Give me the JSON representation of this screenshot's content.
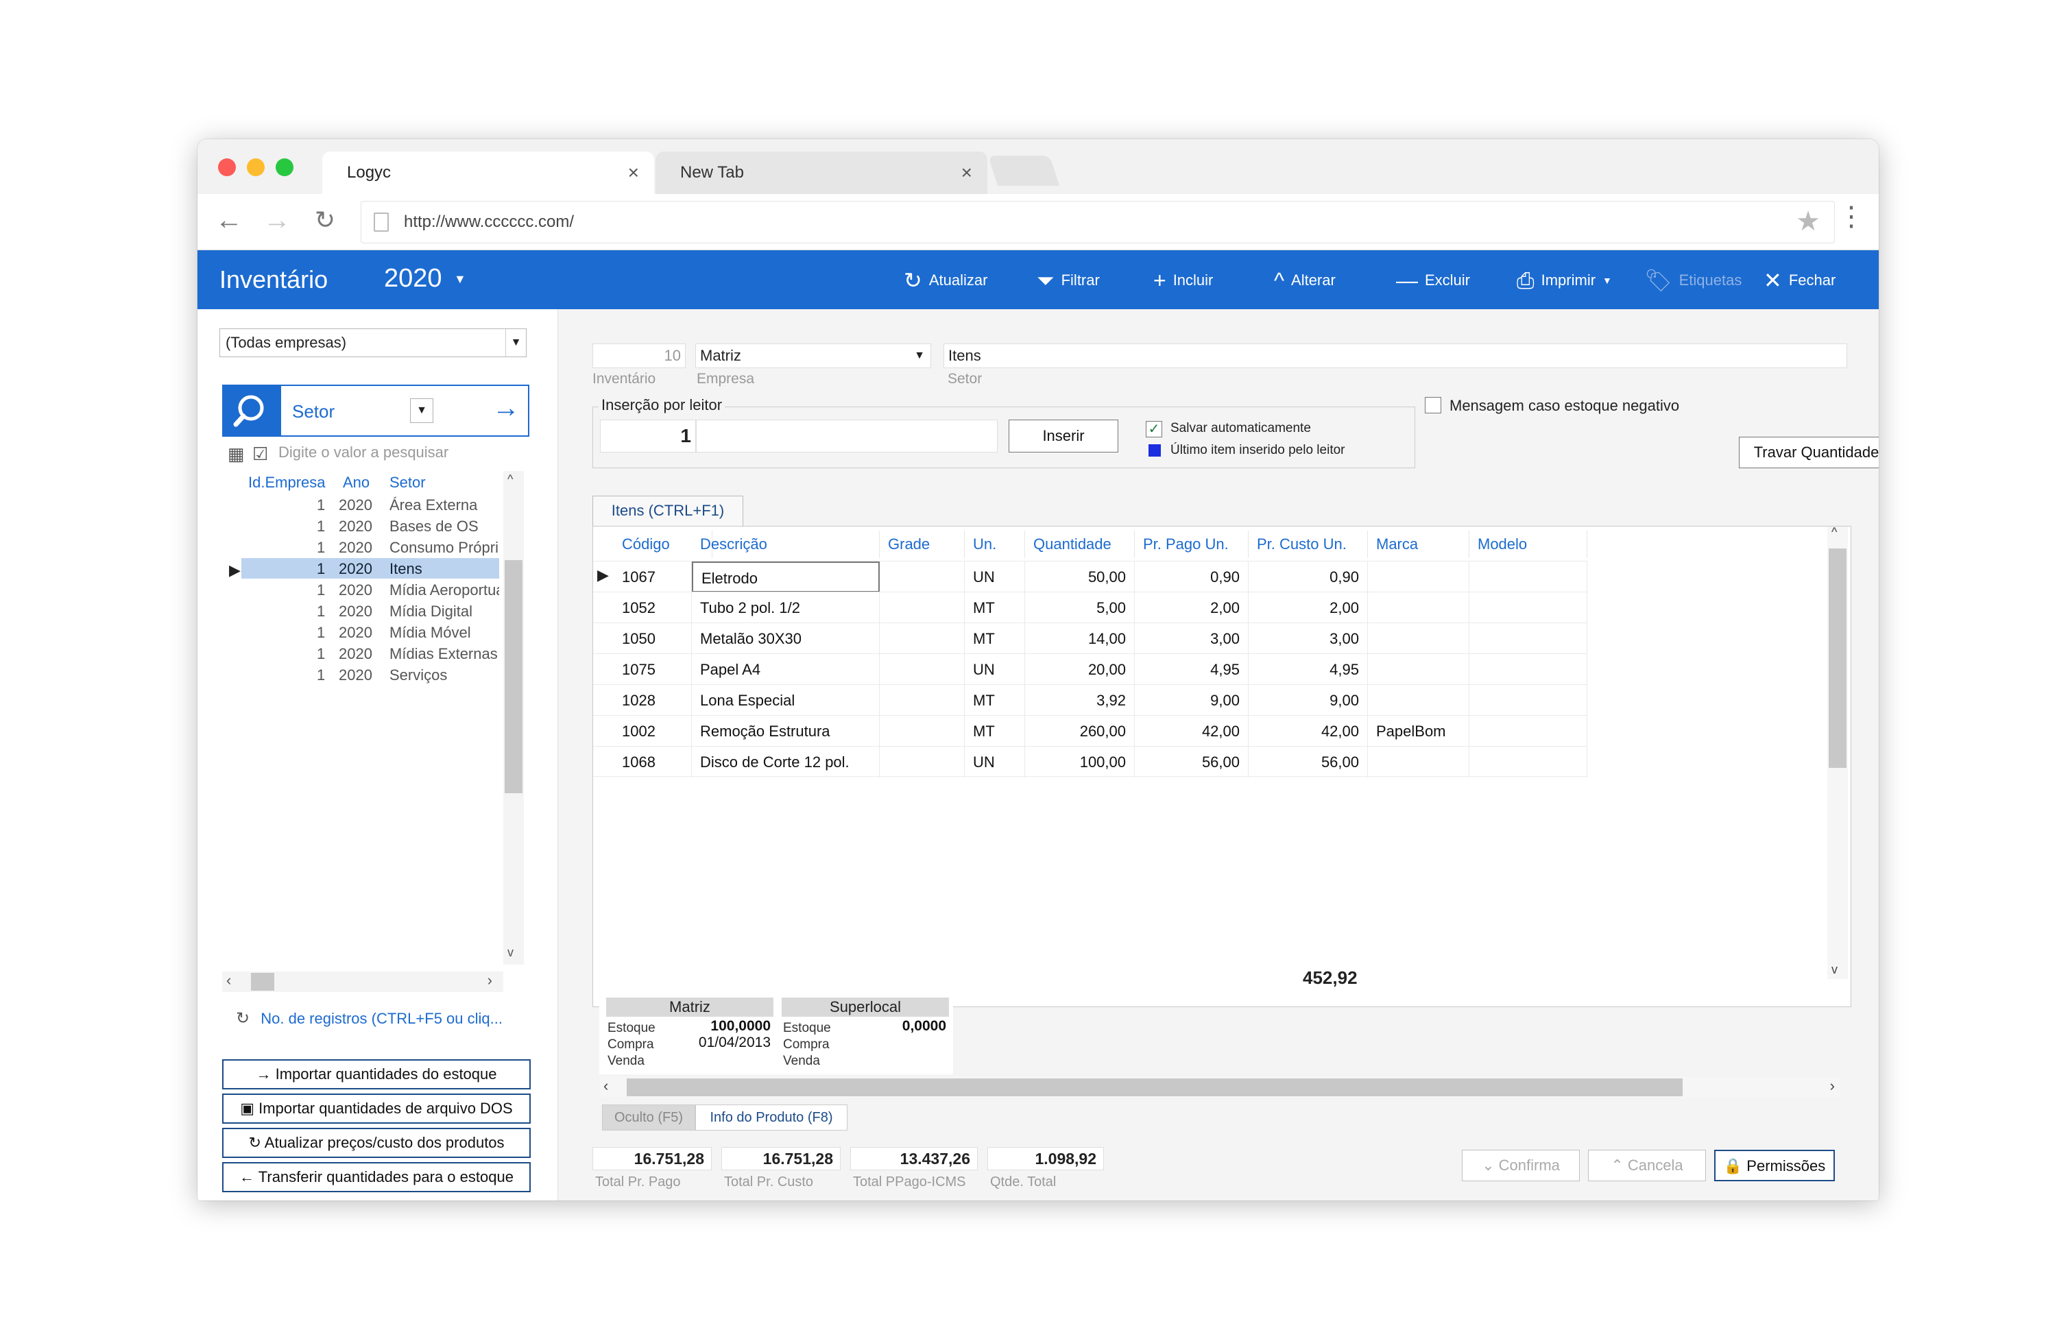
{
  "browser": {
    "tabs": [
      {
        "label": "Logyc"
      },
      {
        "label": "New Tab"
      }
    ],
    "url": "http://www.cccccc.com/"
  },
  "app": {
    "title": "Inventário",
    "year": "2020",
    "toolbar": {
      "atualizar": "Atualizar",
      "filtrar": "Filtrar",
      "incluir": "Incluir",
      "alterar": "Alterar",
      "excluir": "Excluir",
      "imprimir": "Imprimir",
      "etiquetas": "Etiquetas",
      "fechar": "Fechar"
    }
  },
  "left": {
    "company_combo": "(Todas empresas)",
    "search_label": "Setor",
    "search_hint": "Digite o valor a pesquisar",
    "tree_headers": {
      "empresa": "Id.Empresa",
      "ano": "Ano",
      "setor": "Setor"
    },
    "tree_rows": [
      {
        "id": "1",
        "ano": "2020",
        "setor": "Área Externa"
      },
      {
        "id": "1",
        "ano": "2020",
        "setor": "Bases de OS"
      },
      {
        "id": "1",
        "ano": "2020",
        "setor": "Consumo Próprio"
      },
      {
        "id": "1",
        "ano": "2020",
        "setor": "Itens"
      },
      {
        "id": "1",
        "ano": "2020",
        "setor": "Mídia Aeroportuária"
      },
      {
        "id": "1",
        "ano": "2020",
        "setor": "Mídia Digital"
      },
      {
        "id": "1",
        "ano": "2020",
        "setor": "Mídia Móvel"
      },
      {
        "id": "1",
        "ano": "2020",
        "setor": "Mídias Externas"
      },
      {
        "id": "1",
        "ano": "2020",
        "setor": "Serviços"
      }
    ],
    "records_link": "No. de registros (CTRL+F5 ou cliq...",
    "buttons": {
      "importar_estoque": "Importar quantidades do estoque",
      "importar_dos": "Importar quantidades de arquivo DOS",
      "atualizar_precos": "Atualizar preços/custo dos produtos",
      "transferir": "Transferir quantidades para o estoque"
    }
  },
  "form": {
    "inventario_value": "10",
    "inventario_label": "Inventário",
    "empresa_value": "Matriz",
    "empresa_label": "Empresa",
    "setor_value": "Itens",
    "setor_label": "Setor",
    "insercao_title": "Inserção por leitor",
    "insercao_qty": "1",
    "inserir_button": "Inserir",
    "salvar_auto": "Salvar automaticamente",
    "ultimo_item": "Último item inserido pelo leitor",
    "mensagem_estoque": "Mensagem caso estoque negativo",
    "travar_button": "Travar Quantidade",
    "items_tab": "Itens (CTRL+F1)"
  },
  "grid": {
    "headers": {
      "codigo": "Código",
      "descricao": "Descrição",
      "grade": "Grade",
      "un": "Un.",
      "quantidade": "Quantidade",
      "pr_pago": "Pr. Pago Un.",
      "pr_custo": "Pr. Custo Un.",
      "marca": "Marca",
      "modelo": "Modelo"
    },
    "rows": [
      {
        "codigo": "1067",
        "descricao": "Eletrodo",
        "grade": "",
        "un": "UN",
        "quantidade": "50,00",
        "pr_pago": "0,90",
        "pr_custo": "0,90",
        "marca": "",
        "modelo": ""
      },
      {
        "codigo": "1052",
        "descricao": "Tubo 2 pol. 1/2",
        "grade": "",
        "un": "MT",
        "quantidade": "5,00",
        "pr_pago": "2,00",
        "pr_custo": "2,00",
        "marca": "",
        "modelo": ""
      },
      {
        "codigo": "1050",
        "descricao": "Metalão 30X30",
        "grade": "",
        "un": "MT",
        "quantidade": "14,00",
        "pr_pago": "3,00",
        "pr_custo": "3,00",
        "marca": "",
        "modelo": ""
      },
      {
        "codigo": "1075",
        "descricao": "Papel A4",
        "grade": "",
        "un": "UN",
        "quantidade": "20,00",
        "pr_pago": "4,95",
        "pr_custo": "4,95",
        "marca": "",
        "modelo": ""
      },
      {
        "codigo": "1028",
        "descricao": "Lona Especial",
        "grade": "",
        "un": "MT",
        "quantidade": "3,92",
        "pr_pago": "9,00",
        "pr_custo": "9,00",
        "marca": "",
        "modelo": ""
      },
      {
        "codigo": "1002",
        "descricao": "Remoção Estrutura",
        "grade": "",
        "un": "MT",
        "quantidade": "260,00",
        "pr_pago": "42,00",
        "pr_custo": "42,00",
        "marca": "PapelBom",
        "modelo": ""
      },
      {
        "codigo": "1068",
        "descricao": "Disco de Corte 12 pol.",
        "grade": "",
        "un": "UN",
        "quantidade": "100,00",
        "pr_pago": "56,00",
        "pr_custo": "56,00",
        "marca": "",
        "modelo": ""
      }
    ],
    "quantity_total": "452,92"
  },
  "stock": {
    "matriz": {
      "name": "Matriz",
      "estoque_label": "Estoque",
      "estoque": "100,0000",
      "compra_label": "Compra",
      "compra": "01/04/2013",
      "venda_label": "Venda"
    },
    "superlocal": {
      "name": "Superlocal",
      "estoque_label": "Estoque",
      "estoque": "0,0000",
      "compra_label": "Compra",
      "venda_label": "Venda"
    }
  },
  "subtabs": {
    "oculto": "Oculto (F5)",
    "info": "Info do Produto (F8)"
  },
  "totals": [
    {
      "value": "16.751,28",
      "label": "Total Pr. Pago"
    },
    {
      "value": "16.751,28",
      "label": "Total Pr. Custo"
    },
    {
      "value": "13.437,26",
      "label": "Total PPago-ICMS"
    },
    {
      "value": "1.098,92",
      "label": "Qtde. Total"
    }
  ],
  "bottom_buttons": {
    "confirma": "Confirma",
    "cancela": "Cancela",
    "permissoes": "Permissões"
  },
  "colors": {
    "accent": "#1c6bd0",
    "selected_row": "#bcd3f0"
  }
}
